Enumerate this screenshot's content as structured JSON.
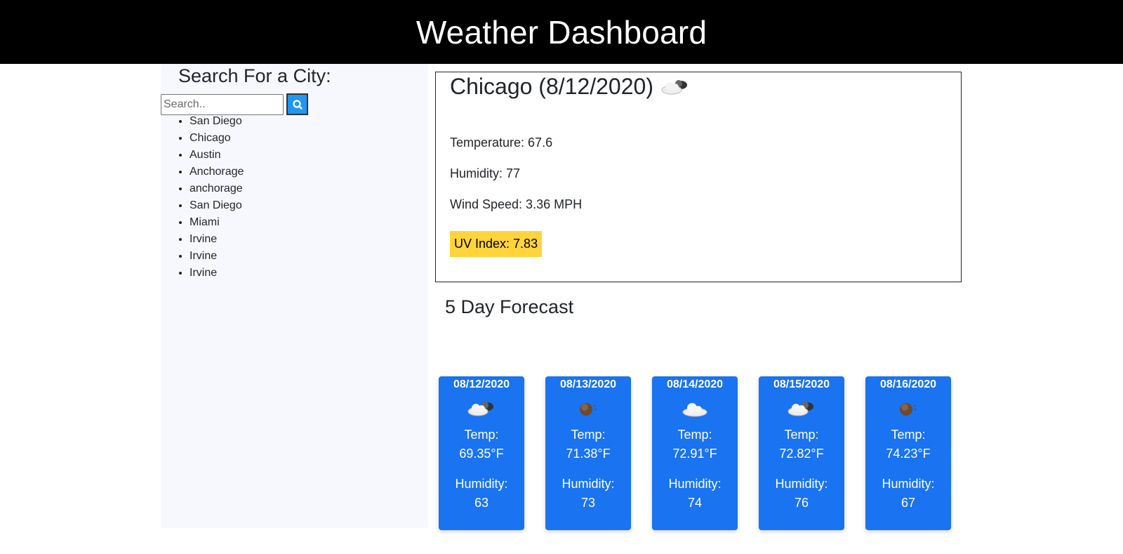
{
  "header": {
    "title": "Weather Dashboard"
  },
  "sidebar": {
    "title": "Search For a City:",
    "search": {
      "placeholder": "Search..",
      "value": "",
      "button_icon": "search-icon"
    },
    "history": [
      "San Diego",
      "Chicago",
      "Austin",
      "Anchorage",
      "anchorage",
      "San Diego",
      "Miami",
      "Irvine",
      "Irvine",
      "Irvine"
    ]
  },
  "current": {
    "title": "Chicago (8/12/2020)",
    "icon": "cloud-moon-icon",
    "temperature": "Temperature: 67.6",
    "humidity": "Humidity: 77",
    "wind": "Wind Speed: 3.36 MPH",
    "uv": "UV Index: 7.83",
    "uv_color": "#ffd43b"
  },
  "forecast": {
    "title": "5 Day Forecast",
    "temp_label": "Temp:",
    "humidity_label": "Humidity:",
    "days": [
      {
        "date": "08/12/2020",
        "icon": "cloud-moon-icon",
        "temp": "69.35°F",
        "humidity": "63"
      },
      {
        "date": "08/13/2020",
        "icon": "moon-icon",
        "temp": "71.38°F",
        "humidity": "73"
      },
      {
        "date": "08/14/2020",
        "icon": "cloud-icon",
        "temp": "72.91°F",
        "humidity": "74"
      },
      {
        "date": "08/15/2020",
        "icon": "cloud-moon-icon",
        "temp": "72.82°F",
        "humidity": "76"
      },
      {
        "date": "08/16/2020",
        "icon": "moon-icon",
        "temp": "74.23°F",
        "humidity": "67"
      }
    ]
  }
}
